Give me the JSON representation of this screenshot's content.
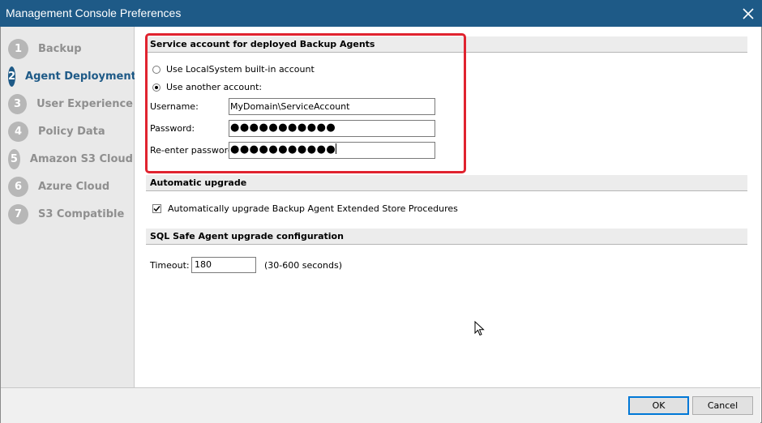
{
  "window": {
    "title": "Management Console Preferences",
    "close_icon": "close-icon",
    "title_bar_color": "#1e5a87"
  },
  "sidebar": {
    "items": [
      {
        "number": "1",
        "label": "Backup",
        "active": false
      },
      {
        "number": "2",
        "label": "Agent Deployment",
        "active": true
      },
      {
        "number": "3",
        "label": "User Experience",
        "active": false
      },
      {
        "number": "4",
        "label": "Policy Data",
        "active": false
      },
      {
        "number": "5",
        "label": "Amazon S3 Cloud",
        "active": false
      },
      {
        "number": "6",
        "label": "Azure Cloud",
        "active": false
      },
      {
        "number": "7",
        "label": "S3 Compatible",
        "active": false
      }
    ]
  },
  "service_account": {
    "header": "Service account for deployed Backup Agents",
    "option_localsystem": "Use LocalSystem built-in account",
    "option_another": "Use another account:",
    "selected_option": "another",
    "username_label": "Username:",
    "username_value": "MyDomain\\ServiceAccount",
    "password_label": "Password:",
    "password_value": "●●●●●●●●●●●",
    "reenter_label": "Re-enter password:",
    "reenter_value": "●●●●●●●●●●●",
    "highlight_color": "#e0232f"
  },
  "automatic_upgrade": {
    "header": "Automatic upgrade",
    "checkbox_label": "Automatically upgrade Backup Agent Extended Store Procedures",
    "checked": true
  },
  "agent_upgrade_config": {
    "header": "SQL Safe Agent upgrade configuration",
    "timeout_label": "Timeout:",
    "timeout_value": "180",
    "timeout_hint": "(30-600 seconds)"
  },
  "footer": {
    "ok_label": "OK",
    "cancel_label": "Cancel"
  }
}
